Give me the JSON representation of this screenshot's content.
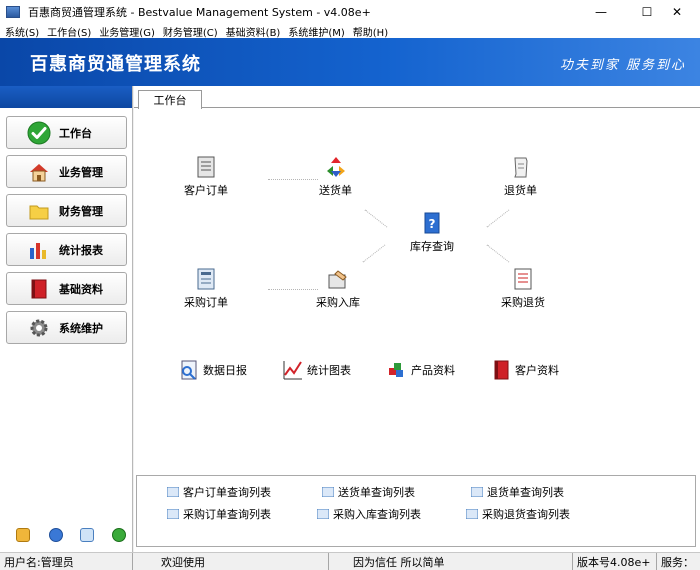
{
  "window": {
    "title": "百惠商贸通管理系统 - Bestvalue Management System - v4.08e+",
    "minimize": "—",
    "maximize": "☐",
    "close": "✕"
  },
  "menu": [
    "系统(S)",
    "工作台(S)",
    "业务管理(G)",
    "财务管理(C)",
    "基础资料(B)",
    "系统维护(M)",
    "帮助(H)"
  ],
  "banner": {
    "title": "百惠商贸通管理系统",
    "slogan": "功夫到家 服务到心"
  },
  "sidebar": {
    "items": [
      {
        "label": "工作台",
        "icon": "green-check-icon"
      },
      {
        "label": "业务管理",
        "icon": "house-icon"
      },
      {
        "label": "财务管理",
        "icon": "folder-icon"
      },
      {
        "label": "统计报表",
        "icon": "bar-chart-icon"
      },
      {
        "label": "基础资料",
        "icon": "red-book-icon"
      },
      {
        "label": "系统维护",
        "icon": "gear-icon"
      }
    ],
    "bottom_icons": [
      "key-icon",
      "clock-icon",
      "search-icon",
      "exit-icon"
    ]
  },
  "main": {
    "tab": "工作台",
    "workflow": {
      "customer_order": "客户订单",
      "delivery": "送货单",
      "return_order": "退货单",
      "inventory_query": "库存查询",
      "purchase_order": "采购订单",
      "purchase_in": "采购入库",
      "purchase_return": "采购退货"
    },
    "reports": {
      "daily": "数据日报",
      "charts": "统计图表",
      "products": "产品资料",
      "customers": "客户资料"
    },
    "queries": [
      "客户订单查询列表",
      "送货单查询列表",
      "退货单查询列表",
      "采购订单查询列表",
      "采购入库查询列表",
      "采购退货查询列表"
    ]
  },
  "status": {
    "user": "用户名:管理员",
    "welcome": "欢迎使用",
    "motto": "因为信任 所以简单",
    "version": "版本号4.08e+",
    "service": "服务："
  },
  "colors": {
    "banner_dark": "#0a47a8",
    "banner_light": "#3c84e2"
  }
}
